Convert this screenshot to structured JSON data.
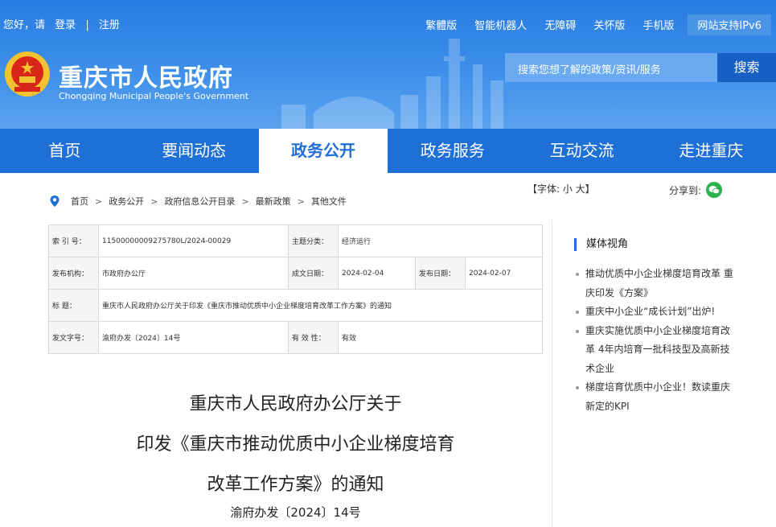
{
  "topbar": {
    "greeting": "您好，请",
    "login": "登录",
    "divider": "|",
    "register": "注册",
    "links": [
      "繁體版",
      "智能机器人",
      "无障碍",
      "关怀版",
      "手机版"
    ],
    "ipv6": "网站支持IPv6"
  },
  "brand": {
    "title_cn": "重庆市人民政府",
    "title_en": "Chongqing Municipal People's Government"
  },
  "search": {
    "placeholder": "搜索您想了解的政策/资讯/服务",
    "button": "搜索"
  },
  "nav": {
    "items": [
      "首页",
      "要闻动态",
      "政务公开",
      "政务服务",
      "互动交流",
      "走进重庆"
    ],
    "active_index": 2
  },
  "breadcrumb": {
    "items": [
      "首页",
      "政务公开",
      "政府信息公开目录",
      "最新政策",
      "其他文件"
    ],
    "separator": ">"
  },
  "fontsize": {
    "label": "【字体: 小 大】"
  },
  "share": {
    "label": "分享到:"
  },
  "meta": {
    "index_label": "索 引 号：",
    "index_value": "11500000009275780L/2024-00029",
    "topic_label": "主题分类：",
    "topic_value": "经济运行",
    "issuer_label": "发布机构：",
    "issuer_value": "市政府办公厅",
    "written_label": "成文日期：",
    "written_value": "2024-02-04",
    "published_label": "发布日期：",
    "published_value": "2024-02-07",
    "title_label": "标 题：",
    "title_value": "重庆市人民政府办公厅关于印发《重庆市推动优质中小企业梯度培育改革工作方案》的通知",
    "docno_label": "发文字号：",
    "docno_value": "渝府办发〔2024〕14号",
    "valid_label": "有 效 性：",
    "valid_value": "有效"
  },
  "document": {
    "title_line1": "重庆市人民政府办公厅关于",
    "title_line2": "印发《重庆市推动优质中小企业梯度培育",
    "title_line3": "改革工作方案》的通知",
    "doc_number": "渝府办发〔2024〕14号"
  },
  "sidebar": {
    "title": "媒体视角",
    "items": [
      "推动优质中小企业梯度培育改革 重庆印发《方案》",
      "重庆中小企业“成长计划”出炉!",
      "重庆实施优质中小企业梯度培育改革 4年内培育一批科技型及高新技术企业",
      "梯度培育优质中小企业！数读重庆新定的KPI"
    ]
  },
  "colors": {
    "header_blue": "#2a7de1",
    "nav_blue": "#1e6fd6",
    "search_button": "#1760c4",
    "wechat_green": "#2bb24c"
  }
}
